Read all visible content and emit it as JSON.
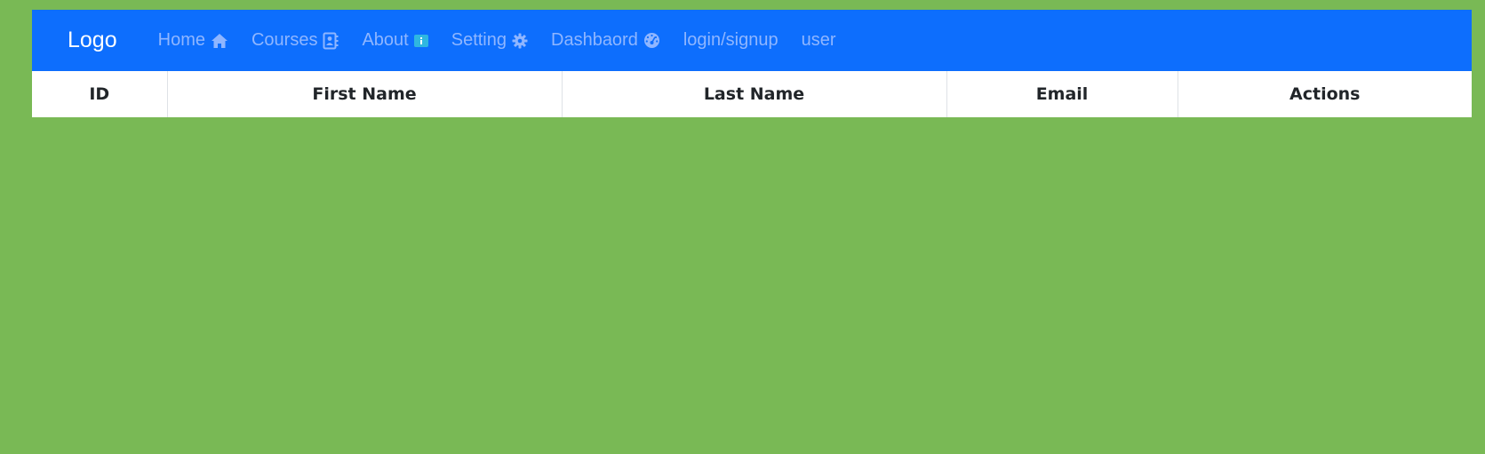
{
  "navbar": {
    "brand": "Logo",
    "bg_color": "#0d6efd",
    "links": [
      {
        "label": "Home",
        "icon": "home-icon"
      },
      {
        "label": "Courses",
        "icon": "contact-card-icon"
      },
      {
        "label": "About",
        "icon": "info-icon"
      },
      {
        "label": "Setting",
        "icon": "gear-icon"
      },
      {
        "label": "Dashbaord",
        "icon": "gauge-icon"
      },
      {
        "label": "login/signup",
        "icon": null
      },
      {
        "label": "user",
        "icon": null
      }
    ]
  },
  "table": {
    "columns": [
      "ID",
      "First Name",
      "Last Name",
      "Email",
      "Actions"
    ],
    "rows": []
  },
  "page": {
    "bg_color": "#79b955"
  }
}
